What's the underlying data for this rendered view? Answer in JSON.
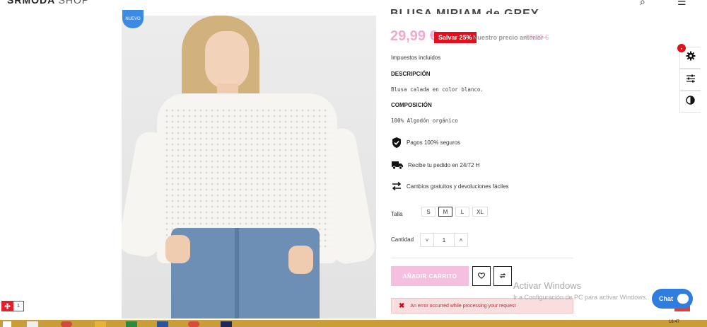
{
  "header": {
    "logo_brand": "SRMODA",
    "logo_suffix": "SHOP"
  },
  "product": {
    "badge": "NUEVO",
    "title": "BLUSA MIRIAM de GREY",
    "price": "29,99 €",
    "save_badge": "Salvar 25%",
    "previous_price_label": "Nuestro precio anterior",
    "previous_price": "39,99 €",
    "tax_note": "Impuestos incluidos",
    "description_heading": "DESCRIPCIÓN",
    "description_text": "Blusa calada en color blanco.",
    "composition_heading": "COMPOSICIÓN",
    "composition_text": "100% Algodón orgánico"
  },
  "features": [
    {
      "icon": "shield-check-icon",
      "label": "Pagos 100% seguros"
    },
    {
      "icon": "truck-icon",
      "label": "Recibe tu pedido en 24/72 H"
    },
    {
      "icon": "swap-arrows-icon",
      "label": "Cambios gratuitos y devoluciones fáciles"
    }
  ],
  "size": {
    "label": "Talla",
    "options": [
      "S",
      "M",
      "L",
      "XL"
    ],
    "selected": "M"
  },
  "quantity": {
    "label": "Cantidad",
    "value": "1",
    "decrement": "˅",
    "increment": "˄"
  },
  "actions": {
    "add_to_cart": "AÑADIR CARRITO"
  },
  "error": {
    "message": "An error occurred while processing your request"
  },
  "watermark": {
    "title": "Activar Windows",
    "subtitle": "Ir a Configuración de PC para activar Windows."
  },
  "chat": {
    "label": "Chat"
  },
  "counter": {
    "value": "1"
  },
  "taskbar": {
    "clock": "16:47"
  },
  "colors": {
    "price_pink": "#f3a8d0",
    "save_red": "#e0101c",
    "chat_blue": "#2f7de0",
    "taskbar": "#c89d3a"
  }
}
